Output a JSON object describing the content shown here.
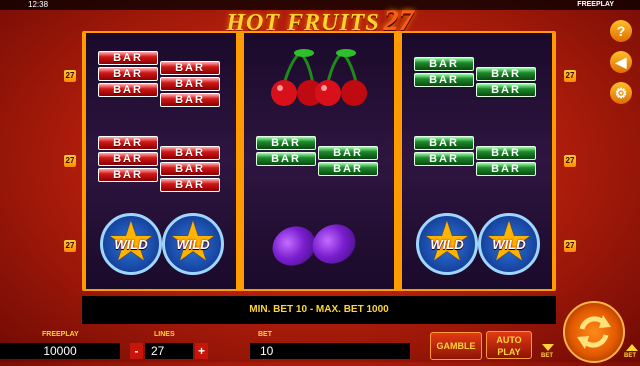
{
  "status_bar": {
    "clock": "12:38",
    "mode": "FREEPLAY"
  },
  "logo": {
    "title": "HOT FRUITS",
    "number": "27"
  },
  "line_indicators": [
    "27",
    "27",
    "27"
  ],
  "reels": [
    [
      "bar-stack-red",
      "bar-stack-red",
      "wild-double"
    ],
    [
      "cherries",
      "bar-stack-green",
      "plums"
    ],
    [
      "bar-stack-green",
      "bar-stack-green",
      "wild-double"
    ]
  ],
  "symbols": {
    "bar": "BAR",
    "wild": "WILD"
  },
  "info_bar": "MIN. BET 10 - MAX. BET 1000",
  "controls": {
    "freeplay_label": "FREEPLAY",
    "freeplay_value": "10000",
    "lines_label": "LINES",
    "lines_value": "27",
    "bet_label": "BET",
    "bet_value": "10",
    "minus": "-",
    "plus": "+",
    "gamble": "GAMBLE",
    "auto": "AUTO",
    "play": "PLAY",
    "bet_small": "BET"
  },
  "side_icons": [
    "help-icon",
    "sound-icon",
    "settings-icon"
  ],
  "colors": {
    "accent": "#ffd43a",
    "reel_frame": "#ff9a00",
    "background": "#b8200c"
  }
}
